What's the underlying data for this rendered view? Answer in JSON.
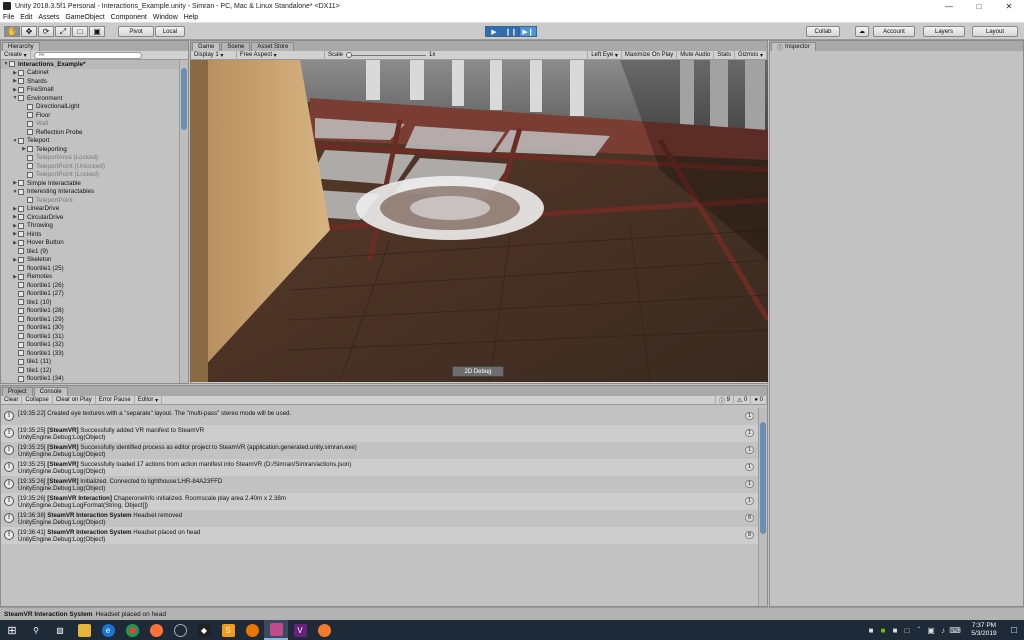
{
  "window": {
    "title": "Unity 2018.3.5f1 Personal - Interactions_Example.unity - Simran - PC, Mac & Linux Standalone* <DX11>",
    "minimize_icon": "minimize-icon",
    "maximize_icon": "maximize-icon",
    "close_icon": "close-icon"
  },
  "menu": [
    "File",
    "Edit",
    "Assets",
    "GameObject",
    "Component",
    "Window",
    "Help"
  ],
  "toolbar": {
    "pivot_label": "Pivot",
    "local_label": "Local",
    "collab_label": "Collab",
    "account_label": "Account",
    "layers_label": "Layers",
    "layout_label": "Layout",
    "play_state": "playing"
  },
  "hierarchy": {
    "tab_label": "Hierarchy",
    "create_label": "Create",
    "search_placeholder": "All",
    "items": [
      {
        "label": "Interactions_Example*",
        "depth": 0,
        "expanded": true,
        "root": true
      },
      {
        "label": "Cabinet",
        "depth": 1,
        "expanded": false
      },
      {
        "label": "Shards",
        "depth": 1,
        "expanded": false
      },
      {
        "label": "FireSmall",
        "depth": 1,
        "expanded": false
      },
      {
        "label": "Environment",
        "depth": 1,
        "expanded": true
      },
      {
        "label": "DirectionalLight",
        "depth": 2
      },
      {
        "label": "Floor",
        "depth": 2
      },
      {
        "label": "Wall",
        "depth": 2,
        "inactive": true
      },
      {
        "label": "Reflection Probe",
        "depth": 2
      },
      {
        "label": "Teleport",
        "depth": 1,
        "expanded": true
      },
      {
        "label": "Teleporting",
        "depth": 2,
        "expanded": false
      },
      {
        "label": "TeleportArea (Locked)",
        "depth": 2,
        "inactive": true
      },
      {
        "label": "TeleportPoint (Unlocked)",
        "depth": 2,
        "inactive": true
      },
      {
        "label": "TeleportPoint (Locked)",
        "depth": 2,
        "inactive": true
      },
      {
        "label": "Simple Interactable",
        "depth": 1,
        "expanded": false
      },
      {
        "label": "Interesting Interactables",
        "depth": 1,
        "expanded": true
      },
      {
        "label": "TeleportPoint",
        "depth": 2,
        "inactive": true
      },
      {
        "label": "LinearDrive",
        "depth": 1,
        "expanded": false
      },
      {
        "label": "CircularDrive",
        "depth": 1,
        "expanded": false
      },
      {
        "label": "Throwing",
        "depth": 1,
        "expanded": false
      },
      {
        "label": "Hints",
        "depth": 1,
        "expanded": false
      },
      {
        "label": "Hover Button",
        "depth": 1,
        "expanded": false
      },
      {
        "label": "tile1 (9)",
        "depth": 1
      },
      {
        "label": "Skeleton",
        "depth": 1,
        "expanded": false
      },
      {
        "label": "floortile1 (25)",
        "depth": 1
      },
      {
        "label": "Remotes",
        "depth": 1,
        "expanded": false
      },
      {
        "label": "floortile1 (26)",
        "depth": 1
      },
      {
        "label": "floortile1 (27)",
        "depth": 1
      },
      {
        "label": "tile1 (10)",
        "depth": 1
      },
      {
        "label": "floortile1 (28)",
        "depth": 1
      },
      {
        "label": "floortile1 (29)",
        "depth": 1
      },
      {
        "label": "floortile1 (30)",
        "depth": 1
      },
      {
        "label": "floortile1 (31)",
        "depth": 1
      },
      {
        "label": "floortile1 (32)",
        "depth": 1
      },
      {
        "label": "floortile1 (33)",
        "depth": 1
      },
      {
        "label": "tile1 (11)",
        "depth": 1
      },
      {
        "label": "tile1 (12)",
        "depth": 1
      },
      {
        "label": "floortile1 (34)",
        "depth": 1
      }
    ]
  },
  "game": {
    "tabs": [
      "Game",
      "Scene",
      "Asset Store"
    ],
    "display": "Display 1",
    "aspect": "Free Aspect",
    "scale_label": "Scale",
    "scale_value": "1x",
    "eye": "Left Eye",
    "options": [
      "Maximize On Play",
      "Mute Audio",
      "Stats",
      "Gizmos"
    ],
    "debug_button": "2D Debug"
  },
  "console": {
    "tabs": [
      "Project",
      "Console"
    ],
    "buttons": [
      "Clear",
      "Collapse",
      "Clear on Play",
      "Error Pause",
      "Editor"
    ],
    "counts": {
      "info": "9",
      "warn": "0",
      "error": "0"
    },
    "entries": [
      {
        "time": "[19:35:22]",
        "bold": "",
        "text": "Created eye textures with a \"separate\" layout.  The \"multi-pass\" stereo mode will be used.",
        "line2": "",
        "count": "1"
      },
      {
        "time": "[19:35:25]",
        "bold": "[SteamVR]",
        "text": "Successfully added VR manifest to SteamVR",
        "line2": "UnityEngine.Debug:Log(Object)",
        "count": "1"
      },
      {
        "time": "[19:35:25]",
        "bold": "[SteamVR]",
        "text": "Successfully identified process as editor project to SteamVR (application.generated.unity.simran.exe)",
        "line2": "UnityEngine.Debug:Log(Object)",
        "count": "1"
      },
      {
        "time": "[19:35:25]",
        "bold": "[SteamVR]",
        "text": "Successfully loaded 17 actions from action manifest into SteamVR (D:/Simran/Simran/actions.json)",
        "line2": "UnityEngine.Debug:Log(Object)",
        "count": "1"
      },
      {
        "time": "[19:35:26]",
        "bold": "[SteamVR]",
        "text": "Initialized. Connected to lighthouse:LHR-84A23FFD",
        "line2": "UnityEngine.Debug:Log(Object)",
        "count": "1"
      },
      {
        "time": "[19:35:26]",
        "bold": "[SteamVR Interaction]",
        "text": "ChaperoneInfo initialized. Roomscale play area 2.40m x 2.38m",
        "line2": "UnityEngine.Debug:LogFormat(String, Object[])",
        "count": "1"
      },
      {
        "time": "[19:36:38]",
        "bold": "SteamVR Interaction System",
        "text": "Headset removed",
        "line2": "UnityEngine.Debug:Log(Object)",
        "count": "8"
      },
      {
        "time": "[19:36:41]",
        "bold": "SteamVR Interaction System",
        "text": "Headset placed on head",
        "line2": "UnityEngine.Debug:Log(Object)",
        "count": "8"
      }
    ]
  },
  "inspector": {
    "tab_label": "Inspector"
  },
  "status": {
    "bold": "SteamVR Interaction System",
    "text": "Headset placed on head"
  },
  "taskbar": {
    "time": "7:37 PM",
    "date": "5/3/2019",
    "apps": [
      "windows-start-icon",
      "search-icon",
      "task-view-icon",
      "file-explorer-icon",
      "edge-icon",
      "chrome-icon",
      "firefox-icon",
      "steam-icon",
      "unity-icon",
      "sublime-icon",
      "blender-orange-icon",
      "unity-active-icon",
      "visual-studio-icon",
      "blender-icon"
    ]
  }
}
